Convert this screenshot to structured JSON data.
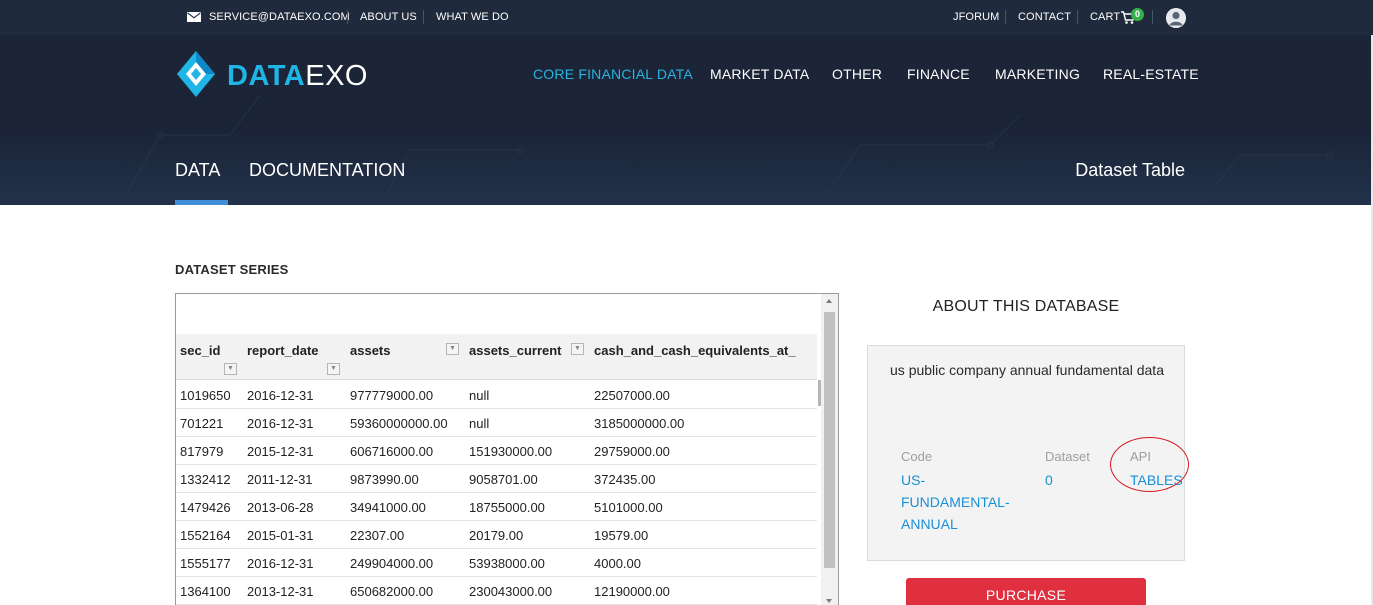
{
  "topbar": {
    "email": "SERVICE@DATAEXO.COM",
    "about_us": "ABOUT US",
    "what_we_do": "WHAT WE DO",
    "jforum": "JFORUM",
    "contact": "CONTACT",
    "cart": "CART",
    "cart_count": "0"
  },
  "logo": {
    "part1": "DATA",
    "part2": "EXO"
  },
  "nav": {
    "core_financial_data": "CORE FINANCIAL DATA",
    "market_data": "MARKET DATA",
    "other": "OTHER",
    "finance": "FINANCE",
    "marketing": "MARKETING",
    "real_estate": "REAL-ESTATE"
  },
  "subnav": {
    "data": "DATA",
    "documentation": "DOCUMENTATION",
    "page_title": "Dataset Table"
  },
  "dataset_series": {
    "title": "DATASET SERIES",
    "columns": [
      "sec_id",
      "report_date",
      "assets",
      "assets_current",
      "cash_and_cash_equivalents_at_"
    ],
    "rows": [
      [
        "1019650",
        "2016-12-31",
        "977779000.00",
        "null",
        "22507000.00"
      ],
      [
        "701221",
        "2016-12-31",
        "59360000000.00",
        "null",
        "3185000000.00"
      ],
      [
        "817979",
        "2015-12-31",
        "606716000.00",
        "151930000.00",
        "29759000.00"
      ],
      [
        "1332412",
        "2011-12-31",
        "9873990.00",
        "9058701.00",
        "372435.00"
      ],
      [
        "1479426",
        "2013-06-28",
        "34941000.00",
        "18755000.00",
        "5101000.00"
      ],
      [
        "1552164",
        "2015-01-31",
        "22307.00",
        "20179.00",
        "19579.00"
      ],
      [
        "1555177",
        "2016-12-31",
        "249904000.00",
        "53938000.00",
        "4000.00"
      ],
      [
        "1364100",
        "2013-12-31",
        "650682000.00",
        "230043000.00",
        "12190000.00"
      ]
    ]
  },
  "about": {
    "title": "ABOUT THIS DATABASE",
    "description": "us public company annual fundamental data",
    "code_label": "Code",
    "code_value_1": "US-",
    "code_value_2": "FUNDAMENTAL-",
    "code_value_3": "ANNUAL",
    "dataset_label": "Dataset",
    "dataset_value": "0",
    "api_label": "API",
    "api_value": "TABLES"
  },
  "purchase_label": "PURCHASE",
  "colors": {
    "brand_blue": "#1fb6e6",
    "nav_active": "#27b4df",
    "header_bg": "#1c2538",
    "link_blue": "#1a8fd6",
    "purchase_red": "#e0303f",
    "annotation_ring": "#d0191d",
    "cart_badge": "#36b24a"
  }
}
